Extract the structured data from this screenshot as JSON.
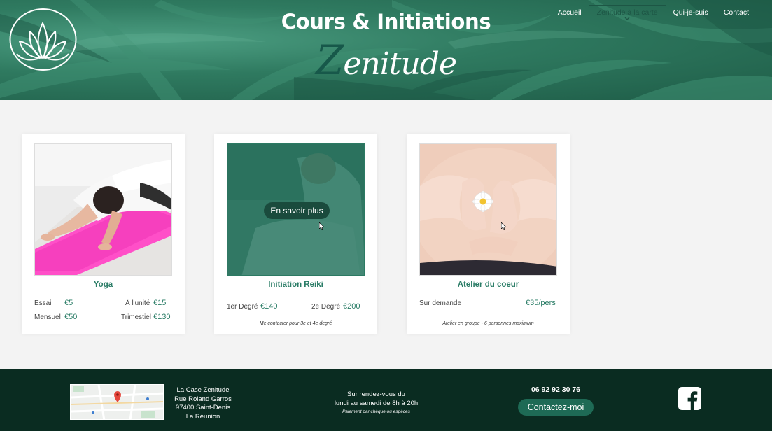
{
  "header": {
    "title": "Cours & Initiations",
    "script_first": "Z",
    "script_rest": "enitude",
    "nav": [
      "Accueil",
      "Zenitude à la carte",
      "Qui-je-suis",
      "Contact"
    ]
  },
  "cards": [
    {
      "name": "Yoga",
      "prices": [
        {
          "label": "Essai",
          "currency": "€",
          "value": "5"
        },
        {
          "label": "À l'unité",
          "currency": "€",
          "value": "15"
        },
        {
          "label": "Mensuel",
          "currency": "€",
          "value": "50"
        },
        {
          "label": "Trimestiel",
          "currency": "€",
          "value": "130"
        }
      ]
    },
    {
      "name": "Initiation Reiki",
      "button": "En savoir plus",
      "prices": [
        {
          "label": "1er Degré",
          "currency": "€",
          "value": "140"
        },
        {
          "label": "2e Degré",
          "currency": "€",
          "value": "200"
        }
      ],
      "note": "Me contacter pour 3e et 4e degré"
    },
    {
      "name": "Atelier du coeur",
      "prices": [
        {
          "label": "Sur demande",
          "currency": "€",
          "value": "35/pers"
        }
      ],
      "note": "Atelier en groupe - 6 personnes maximum"
    }
  ],
  "footer": {
    "address": [
      "La Case Zenitude",
      "Rue Roland Garros",
      "97400 Saint-Denis",
      "La Réunion"
    ],
    "hours": [
      "Sur rendez-vous du",
      "lundi au samedi de 8h à 20h"
    ],
    "payment": "Paiement par chèque ou espèces",
    "phone": "06 92 92 30 76",
    "contact_button": "Contactez-moi"
  },
  "colors": {
    "accent": "#2a7c66",
    "footer": "#0a2c21",
    "button_dark": "#1a4b3d"
  }
}
